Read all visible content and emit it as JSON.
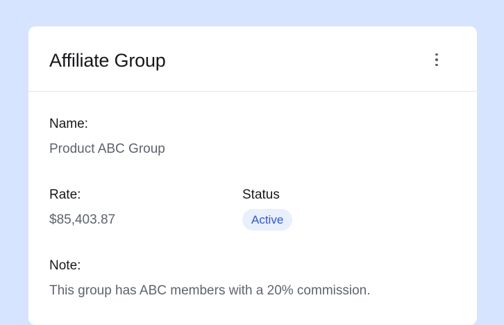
{
  "card": {
    "title": "Affiliate Group",
    "menu_icon": "more-vertical-icon",
    "fields": {
      "name": {
        "label": "Name:",
        "value": "Product ABC Group"
      },
      "rate": {
        "label": "Rate:",
        "value": "$85,403.87"
      },
      "status": {
        "label": "Status",
        "value": "Active"
      },
      "note": {
        "label": "Note:",
        "value": "This group has ABC members with a 20% commission."
      }
    }
  },
  "colors": {
    "background": "#d6e4ff",
    "card": "#ffffff",
    "badge_background": "#e8effd",
    "badge_text": "#2f58c6"
  }
}
